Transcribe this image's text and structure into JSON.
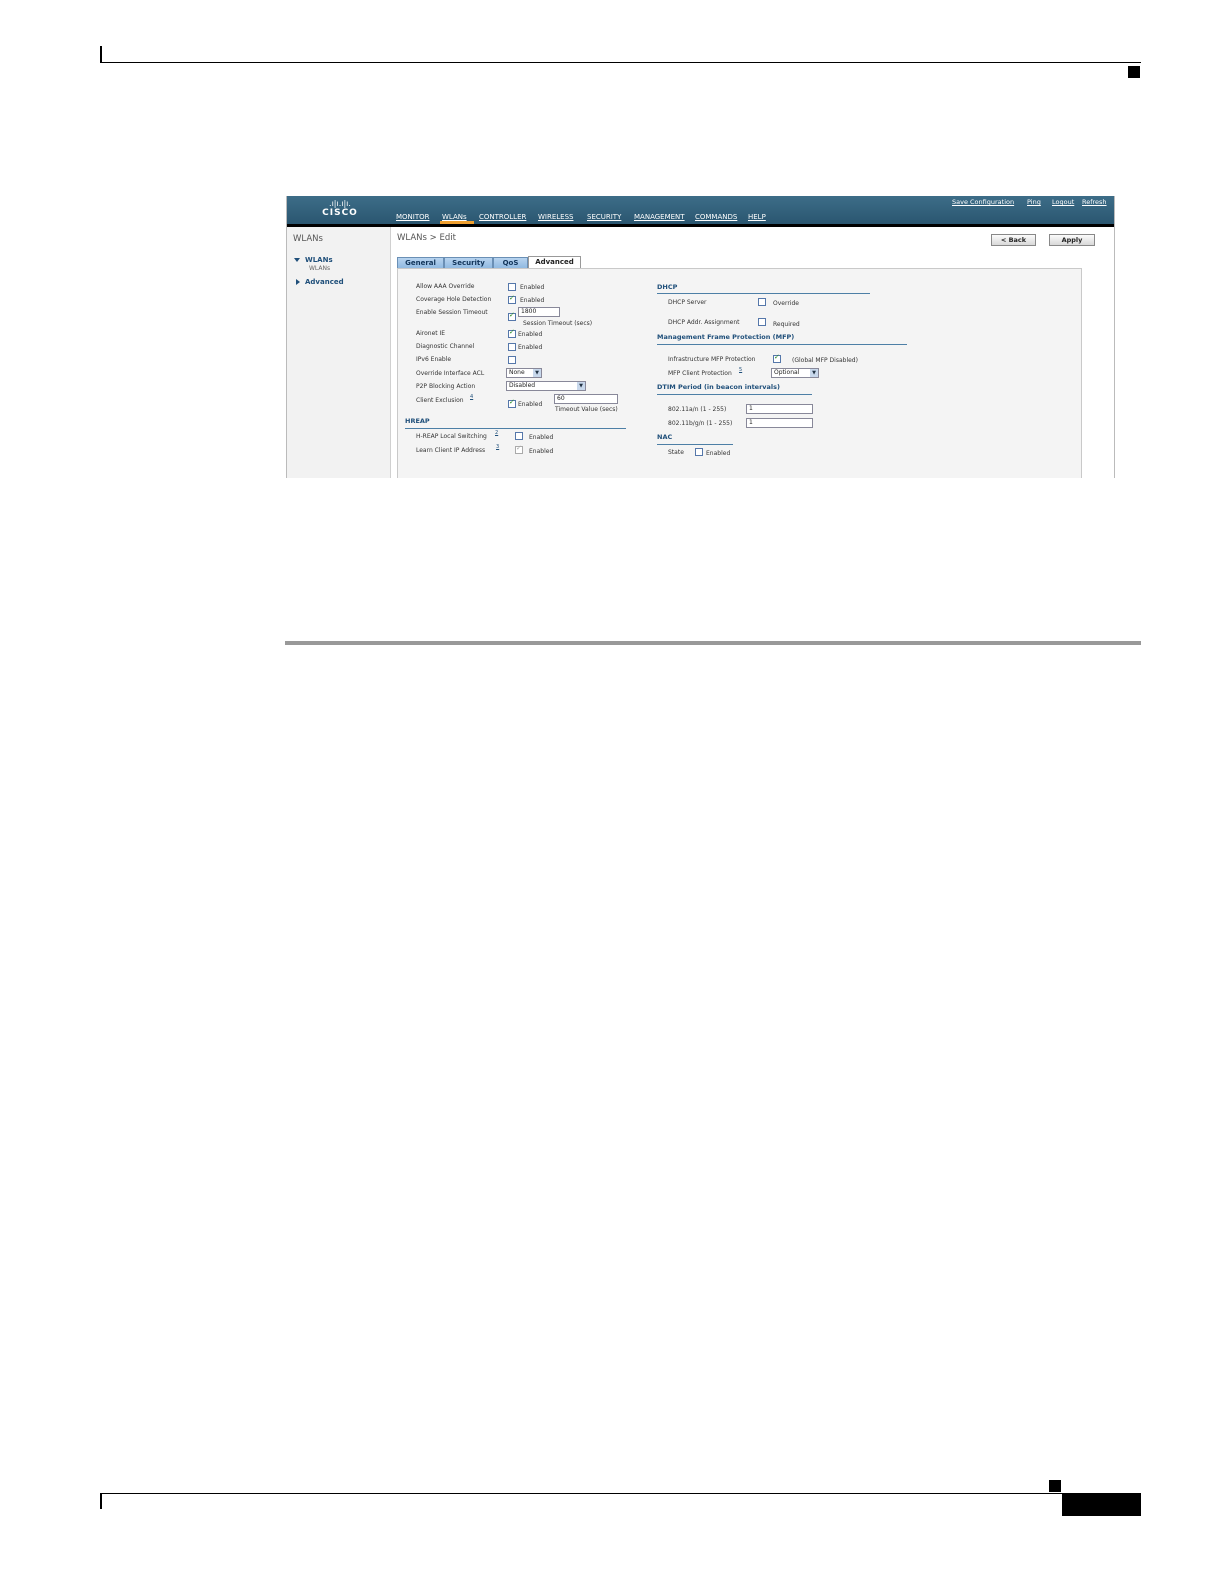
{
  "figure_id": "250762",
  "header": {
    "logo_bars": ".ı|ı.ı|ı.",
    "logo_word": "CISCO",
    "nav": [
      "MONITOR",
      "WLANs",
      "CONTROLLER",
      "WIRELESS",
      "SECURITY",
      "MANAGEMENT",
      "COMMANDS",
      "HELP"
    ],
    "active_nav": "WLANs",
    "utility": {
      "save": "Save Configuration",
      "ping": "Ping",
      "logout": "Logout",
      "refresh": "Refresh"
    }
  },
  "sidebar": {
    "title": "WLANs",
    "items": [
      {
        "label": "WLANs",
        "sub": "WLANs"
      },
      {
        "label": "Advanced"
      }
    ]
  },
  "content": {
    "breadcrumb": "WLANs > Edit",
    "back_button": "< Back",
    "apply_button": "Apply",
    "tabs": [
      "General",
      "Security",
      "QoS",
      "Advanced"
    ],
    "active_tab": "Advanced"
  },
  "left": {
    "allow_aaa": {
      "label": "Allow AAA Override",
      "text": "Enabled",
      "checked": false
    },
    "coverage_hole": {
      "label": "Coverage Hole Detection",
      "text": "Enabled",
      "checked": true
    },
    "session_timeout": {
      "label": "Enable Session Timeout",
      "value": "1800",
      "caption": "Session Timeout (secs)",
      "checked": true
    },
    "aironet_ie": {
      "label": "Aironet IE",
      "text": "Enabled",
      "checked": true
    },
    "diag_channel": {
      "label": "Diagnostic Channel",
      "text": "Enabled",
      "checked": false
    },
    "ipv6": {
      "label": "IPv6 Enable",
      "checked": false
    },
    "override_acl": {
      "label": "Override Interface ACL",
      "selected": "None"
    },
    "p2p": {
      "label": "P2P Blocking Action",
      "selected": "Disabled"
    },
    "client_exclusion": {
      "label": "Client Exclusion",
      "note": "4",
      "text": "Enabled",
      "value": "60",
      "caption": "Timeout Value (secs)",
      "checked": true
    },
    "hreap": {
      "title": "HREAP",
      "local_switching": {
        "label": "H-REAP Local Switching",
        "note": "2",
        "text": "Enabled",
        "checked": false
      },
      "learn_ip": {
        "label": "Learn Client IP Address",
        "note": "3",
        "text": "Enabled",
        "checked": true
      }
    }
  },
  "right": {
    "dhcp": {
      "title": "DHCP",
      "server": {
        "label": "DHCP Server",
        "text": "Override",
        "checked": false
      },
      "assignment": {
        "label": "DHCP Addr. Assignment",
        "text": "Required",
        "checked": false
      }
    },
    "mfp": {
      "title": "Management Frame Protection (MFP)",
      "infra": {
        "label": "Infrastructure MFP Protection",
        "text": "(Global MFP Disabled)",
        "checked": true
      },
      "client": {
        "label": "MFP Client Protection",
        "note": "5",
        "selected": "Optional"
      }
    },
    "dtim": {
      "title": "DTIM Period (in beacon intervals)",
      "a": {
        "label": "802.11a/n (1 - 255)",
        "value": "1"
      },
      "b": {
        "label": "802.11b/g/n (1 - 255)",
        "value": "1"
      }
    },
    "nac": {
      "title": "NAC",
      "state": {
        "label": "State",
        "text": "Enabled",
        "checked": false
      }
    }
  }
}
